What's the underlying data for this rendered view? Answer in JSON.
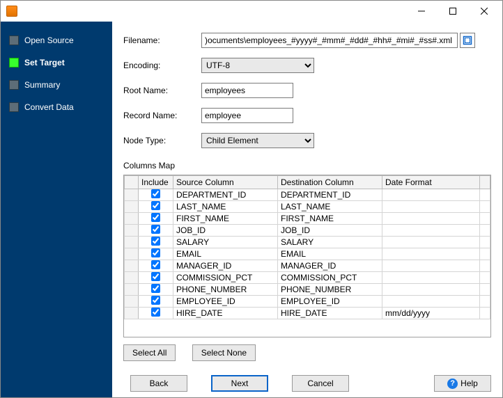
{
  "sidebar": {
    "items": [
      {
        "label": "Open Source"
      },
      {
        "label": "Set Target"
      },
      {
        "label": "Summary"
      },
      {
        "label": "Convert Data"
      }
    ]
  },
  "form": {
    "filename_label": "Filename:",
    "filename_value": ")ocuments\\employees_#yyyy#_#mm#_#dd#_#hh#_#mi#_#ss#.xml",
    "encoding_label": "Encoding:",
    "encoding_value": "UTF-8",
    "root_label": "Root Name:",
    "root_value": "employees",
    "record_label": "Record Name:",
    "record_value": "employee",
    "nodetype_label": "Node Type:",
    "nodetype_value": "Child Element"
  },
  "columns": {
    "title": "Columns Map",
    "headers": {
      "include": "Include",
      "source": "Source Column",
      "dest": "Destination Column",
      "fmt": "Date Format"
    },
    "rows": [
      {
        "include": true,
        "source": "DEPARTMENT_ID",
        "dest": "DEPARTMENT_ID",
        "fmt": ""
      },
      {
        "include": true,
        "source": "LAST_NAME",
        "dest": "LAST_NAME",
        "fmt": ""
      },
      {
        "include": true,
        "source": "FIRST_NAME",
        "dest": "FIRST_NAME",
        "fmt": ""
      },
      {
        "include": true,
        "source": "JOB_ID",
        "dest": "JOB_ID",
        "fmt": ""
      },
      {
        "include": true,
        "source": "SALARY",
        "dest": "SALARY",
        "fmt": ""
      },
      {
        "include": true,
        "source": "EMAIL",
        "dest": "EMAIL",
        "fmt": ""
      },
      {
        "include": true,
        "source": "MANAGER_ID",
        "dest": "MANAGER_ID",
        "fmt": ""
      },
      {
        "include": true,
        "source": "COMMISSION_PCT",
        "dest": "COMMISSION_PCT",
        "fmt": ""
      },
      {
        "include": true,
        "source": "PHONE_NUMBER",
        "dest": "PHONE_NUMBER",
        "fmt": ""
      },
      {
        "include": true,
        "source": "EMPLOYEE_ID",
        "dest": "EMPLOYEE_ID",
        "fmt": ""
      },
      {
        "include": true,
        "source": "HIRE_DATE",
        "dest": "HIRE_DATE",
        "fmt": "mm/dd/yyyy"
      }
    ]
  },
  "buttons": {
    "select_all": "Select All",
    "select_none": "Select None",
    "back": "Back",
    "next": "Next",
    "cancel": "Cancel",
    "help": "Help"
  }
}
